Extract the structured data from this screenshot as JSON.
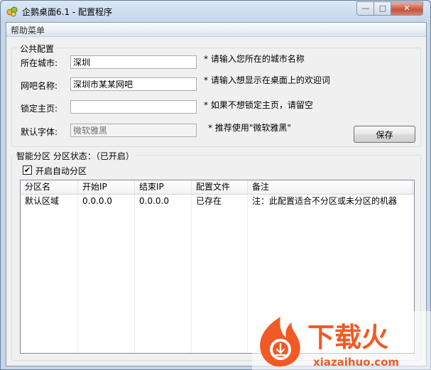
{
  "window": {
    "title": "企鹅桌面6.1 - 配置程序",
    "min": "—",
    "max": "□",
    "close": "✕"
  },
  "menu": {
    "help": "帮助菜单"
  },
  "public_config": {
    "legend": "公共配置",
    "city_label": "所在城市:",
    "city_value": "深圳",
    "city_hint": "* 请输入您所在的城市名称",
    "cafe_label": "网吧名称:",
    "cafe_value": "深圳市某某网吧",
    "cafe_hint": "* 请输入想显示在桌面上的欢迎词",
    "home_label": "锁定主页:",
    "home_value": "",
    "home_hint": "* 如果不想锁定主页，请留空",
    "font_label": "默认字体:",
    "font_value": "微软雅黑",
    "font_hint": "* 推荐使用\"微软雅黑\"",
    "save": "保存"
  },
  "partition": {
    "legend": "智能分区 分区状态：（已开启）",
    "auto_checked": "✔",
    "auto_label": "开启自动分区",
    "columns": [
      "分区名",
      "开始IP",
      "结束IP",
      "配置文件",
      "备注"
    ],
    "rows": [
      [
        "默认区域",
        "0.0.0.0",
        "0.0.0.0",
        "已存在",
        "注：此配置适合不分区或未分区的机器"
      ]
    ]
  },
  "watermark": {
    "text": "下载火",
    "url": "xiazaihuo.com"
  },
  "colors": {
    "accent": "#f15a24",
    "title_bar": "#c5d6e9",
    "close_button": "#c4523a"
  },
  "icons": {
    "app": "app-logo-icon",
    "checkbox": "check-icon",
    "watermark": "download-flame-logo"
  }
}
